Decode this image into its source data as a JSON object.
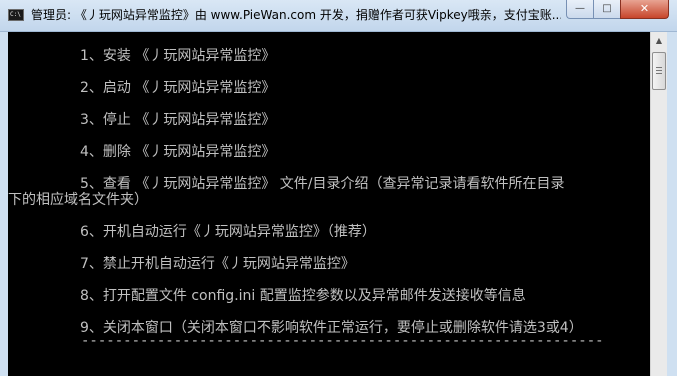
{
  "window": {
    "title": "管理员: 《丿玩网站异常监控》由 www.PieWan.com 开发，捐赠作者可获Vipkey哦亲，支付宝账...",
    "app_icon": "cmd-console-icon",
    "controls": {
      "minimize": "minimize-icon",
      "maximize": "maximize-icon",
      "close": "close-icon"
    }
  },
  "console": {
    "menu": [
      {
        "line1": "1、安装 《丿玩网站异常监控》"
      },
      {
        "line1": "2、启动 《丿玩网站异常监控》"
      },
      {
        "line1": "3、停止 《丿玩网站异常监控》"
      },
      {
        "line1": "4、删除 《丿玩网站异常监控》"
      },
      {
        "line1": "5、查看 《丿玩网站异常监控》 文件/目录介绍（查异常记录请看软件所在目录",
        "line2": "下的相应域名文件夹）"
      },
      {
        "line1": "6、开机自动运行《丿玩网站异常监控》（推荐）"
      },
      {
        "line1": "7、禁止开机自动运行《丿玩网站异常监控》"
      },
      {
        "line1": "8、打开配置文件 config.ini 配置监控参数以及异常邮件发送接收等信息"
      },
      {
        "line1": "9、关闭本窗口（关闭本窗口不影响软件正常运行，要停止或删除软件请选3或4）"
      }
    ],
    "separator": "--------------------------------------------------------------"
  },
  "colors": {
    "console_bg": "#000000",
    "console_text": "#c0c0c0",
    "titlebar": "#c8dbef",
    "close_button": "#c7452b"
  }
}
